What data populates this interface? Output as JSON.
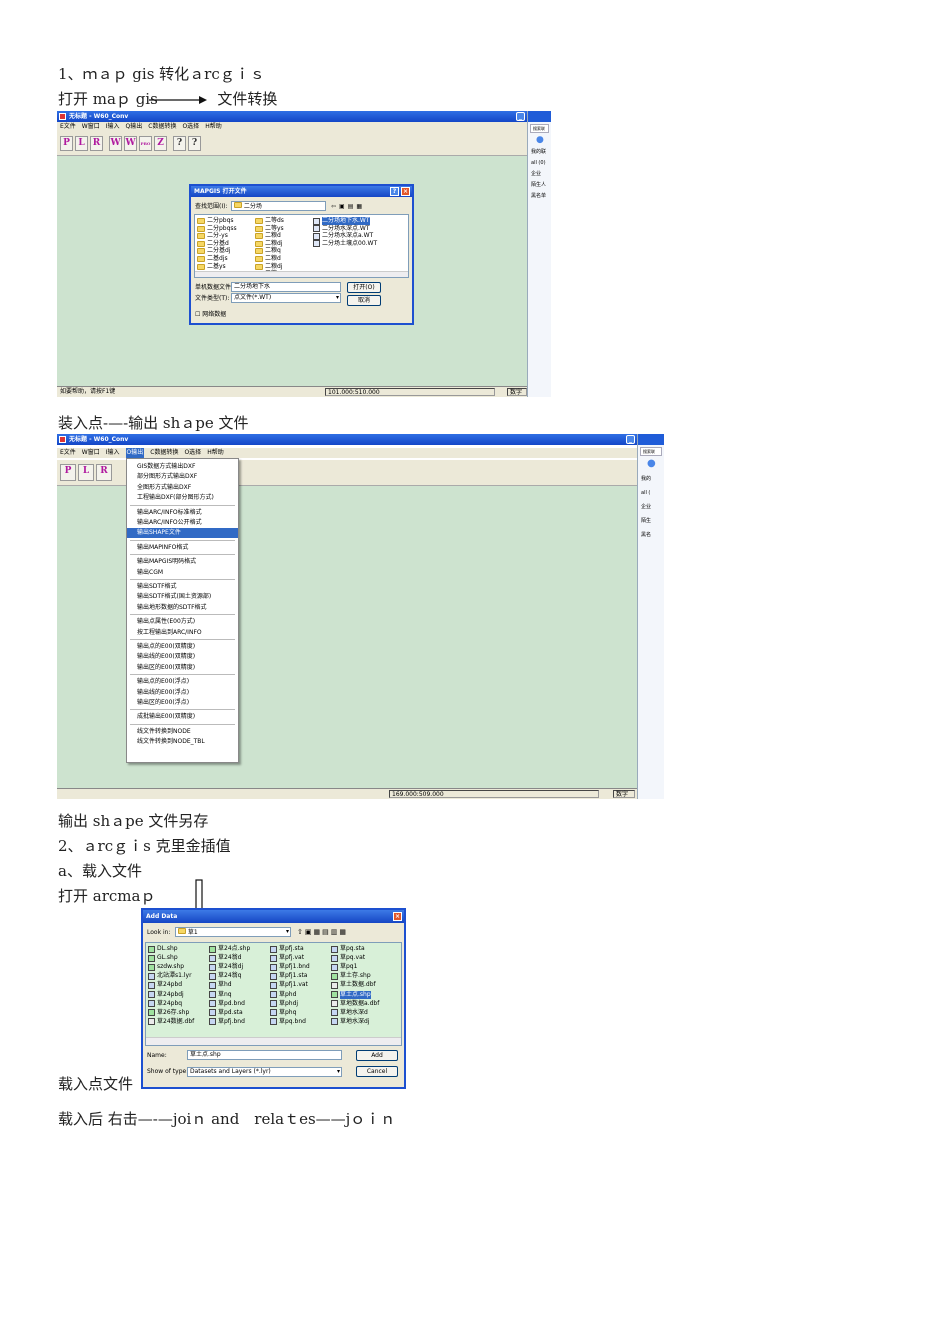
{
  "doc": {
    "line1": "1、ｍａｐ gis 转化ａrcｇｉｓ",
    "line2a": "打开 maｐ gis",
    "line2b": "文件转换",
    "line3": "装入点-—-输出 shａpe 文件",
    "line4": "输出 shａpe 文件另存",
    "line5": "2、ａrcｇｉs 克里金插值",
    "line6": "a、载入文件",
    "line7": "打开 arcmaｐ",
    "line8": "载入点文件",
    "line9": "载入后 右击—-—joiｎ and　relaｔes——jｏｉｎ"
  },
  "shot1": {
    "title": "无标题 - W60_Conv",
    "menus": [
      "E文件",
      "W窗口",
      "I输入",
      "Q输出",
      "C数据转换",
      "O选择",
      "H帮助"
    ],
    "toolbar": [
      "P",
      "L",
      "R",
      "W",
      "W",
      "PRO",
      "Z",
      "?",
      "?"
    ],
    "status": [
      "如要帮助，请按F1键",
      "101.000:510.000",
      "数字"
    ],
    "side": {
      "header": "",
      "search": "搜索联",
      "items": [
        "我的联",
        "all (0)",
        "企业",
        "陌生人",
        "黑名单"
      ]
    },
    "dialog": {
      "title": "MAPGIS 打开文件",
      "look_label": "查找范围(I):",
      "look_value": "二分场",
      "files": [
        {
          "name": "二分pbqs",
          "kind": "folder"
        },
        {
          "name": "二分pbqss",
          "kind": "folder"
        },
        {
          "name": "二分-ys",
          "kind": "folder"
        },
        {
          "name": "二分基d",
          "kind": "folder"
        },
        {
          "name": "二分基dj",
          "kind": "folder"
        },
        {
          "name": "二基djs",
          "kind": "folder"
        },
        {
          "name": "二基ys",
          "kind": "folder"
        },
        {
          "name": "二等ds",
          "kind": "folder"
        },
        {
          "name": "二等ys",
          "kind": "folder"
        },
        {
          "name": "二粮d",
          "kind": "folder"
        },
        {
          "name": "二粮dj",
          "kind": "folder"
        },
        {
          "name": "二粮q",
          "kind": "folder"
        },
        {
          "name": "二粮d",
          "kind": "folder"
        },
        {
          "name": "二粮dj",
          "kind": "folder"
        },
        {
          "name": "二粮q",
          "kind": "folder"
        },
        {
          "name": "二分场地下水.WT",
          "kind": "file",
          "selected": true
        },
        {
          "name": "二分场水深点.WT",
          "kind": "file"
        },
        {
          "name": "二分场水深点a.WT",
          "kind": "file"
        },
        {
          "name": "二分场土壤点00.WT",
          "kind": "file"
        }
      ],
      "name_label": "单机数据文件",
      "name_value": "二分场地下水",
      "type_label": "文件类型(T):",
      "type_value": "点文件(*.WT)",
      "open": "打开(O)",
      "cancel": "取消",
      "net": "网络数据"
    }
  },
  "shot2": {
    "title": "无标题 - W60_Conv",
    "menus": [
      "E文件",
      "W窗口",
      "I输入",
      "O输出",
      "C数据转换",
      "O选择",
      "H帮助"
    ],
    "toolbar": [
      "P",
      "L",
      "R"
    ],
    "status": [
      "",
      "169.000:509.000",
      "数字"
    ],
    "side": {
      "header": "",
      "search": "搜索联",
      "items": [
        "我的",
        "all (",
        "企业",
        "陌生",
        "黑名"
      ]
    },
    "menu_groups": [
      [
        "GIS数据方式输出DXF",
        "部分图形方式输出DXF",
        "全图形方式输出DXF",
        "工程输出DXF(部分图形方式)"
      ],
      [
        "输出ARC/INFO标准格式",
        "输出ARC/INFO公开格式",
        "输出SHAPE文件"
      ],
      [
        "输出MAPINFO格式"
      ],
      [
        "输出MAPGIS明码格式",
        "输出CGM"
      ],
      [
        "输出SDTF格式",
        "输出SDTF格式(国土资源部)",
        "输出地形数据的SDTF格式"
      ],
      [
        "输出点属性(E00方式)",
        "按工程输出到ARC/INFO"
      ],
      [
        "输出点的E00(双精度)",
        "输出线的E00(双精度)",
        "输出区的E00(双精度)"
      ],
      [
        "输出点的E00(浮点)",
        "输出线的E00(浮点)",
        "输出区的E00(浮点)"
      ],
      [
        "成批输出E00(双精度)"
      ],
      [
        "线文件转换到NODE",
        "线文件转换到NODE_TBL"
      ]
    ],
    "highlighted": "输出SHAPE文件"
  },
  "shot3": {
    "title": "Add Data",
    "look_label": "Look in:",
    "look_value": "草1",
    "files": [
      "DL.shp",
      "GL.shp",
      "szdw.shp",
      "北站潭s1.lyr",
      "草24pbd",
      "草24pbdj",
      "草24pbq",
      "草26存.shp",
      "草24数据.dbf",
      "草24点.shp",
      "草24翁d",
      "草24翁dj",
      "草24翁q",
      "草hd",
      "草nq",
      "草pd.bnd",
      "草pd.sta",
      "草pfj.bnd",
      "草pfj.sta",
      "草pfj.vat",
      "草pfj1.bnd",
      "草pfj1.sta",
      "草pfj1.vat",
      "草phd",
      "草phdj",
      "草phq",
      "草pq.bnd",
      "草pq.sta",
      "草pq.vat",
      "草pq1",
      "草土存.shp",
      "草土数据.dbf",
      "草土点.shp",
      "草地数据a.dbf",
      "草地水深d",
      "草地水深dj"
    ],
    "selected": "草土点.shp",
    "name_label": "Name:",
    "name_value": "草土点.shp",
    "type_label": "Show of type:",
    "type_value": "Datasets and Layers (*.lyr)",
    "add": "Add",
    "cancel": "Cancel"
  }
}
